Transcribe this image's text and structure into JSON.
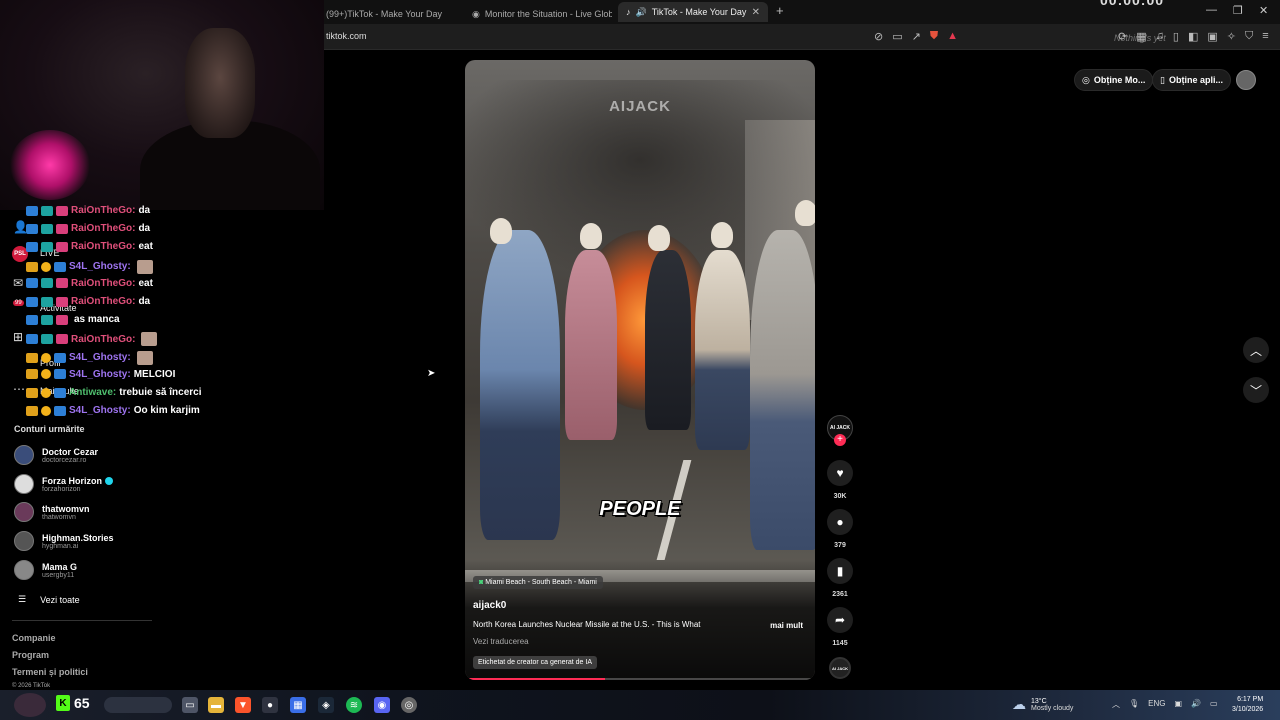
{
  "browser": {
    "tabs": [
      {
        "title": "(99+)TikTok - Make Your Day",
        "active": false
      },
      {
        "title": "Monitor the Situation - Live Global N",
        "active": false
      },
      {
        "title": "TikTok - Make Your Day",
        "active": true
      }
    ],
    "new_tab": "+",
    "close_tab": "✕",
    "url": "tiktok.com",
    "ghost_text": "Nothing's yet",
    "clock_overlay": "00:00:00",
    "window_controls": [
      "—",
      "❐",
      "✕"
    ]
  },
  "chat": {
    "lines": [
      {
        "user": "RaiOnTheGo:",
        "message": "da",
        "user_type": "rai",
        "emote": false
      },
      {
        "user": "RaiOnTheGo:",
        "message": "da",
        "user_type": "rai",
        "emote": false
      },
      {
        "user": "RaiOnTheGo:",
        "message": "eat",
        "user_type": "rai",
        "emote": false
      },
      {
        "user": "S4L_Ghosty:",
        "message": "",
        "user_type": "s4l",
        "emote": true
      },
      {
        "user": "RaiOnTheGo:",
        "message": "eat",
        "user_type": "rai",
        "emote": false
      },
      {
        "user": "RaiOnTheGo:",
        "message": "da",
        "user_type": "rai",
        "emote": false
      },
      {
        "user": "",
        "message": "as manca",
        "user_type": "rai",
        "emote": false
      },
      {
        "user": "RaiOnTheGo:",
        "message": "",
        "user_type": "rai",
        "emote": true
      },
      {
        "user": "S4L_Ghosty:",
        "message": "",
        "user_type": "s4l",
        "emote": true
      },
      {
        "user": "S4L_Ghosty:",
        "message": "MELCIOI",
        "user_type": "s4l",
        "emote": false
      },
      {
        "user": "Antiwave:",
        "message": "trebuie să încerci",
        "user_type": "anti",
        "emote": false
      },
      {
        "user": "S4L_Ghosty:",
        "message": "Oo kim karjim",
        "user_type": "s4l",
        "emote": false
      }
    ]
  },
  "sidebar": {
    "nav_labels": {
      "live": "LIVE",
      "activity": "Activitate",
      "profile": "Profil",
      "more": "Mai multe"
    },
    "live_badge": "PSL",
    "activity_count": "99",
    "following_title": "Conturi urmărite",
    "following": [
      {
        "name": "Doctor Cezar",
        "handle": "doctorcezar.ro",
        "verified": false
      },
      {
        "name": "Forza Horizon",
        "handle": "forzahorizon",
        "verified": true
      },
      {
        "name": "thatwomvn",
        "handle": "thatwomvn",
        "verified": false
      },
      {
        "name": "Highman.Stories",
        "handle": "hyghman.ai",
        "verified": false
      },
      {
        "name": "Mama G",
        "handle": "usergby11",
        "verified": false
      }
    ],
    "see_all": "Vezi toate",
    "footer_links": [
      "Companie",
      "Program",
      "Termeni și politici"
    ],
    "footer_small": "© 2026 TikTok"
  },
  "video": {
    "watermark": "AIJACK",
    "caption": "PEOPLE",
    "location": "Miami Beach - South Beach - Miami",
    "author": "aijack0",
    "description": "North Korea Launches Nuclear Missile at the U.S. - This is What",
    "more": "mai mult",
    "translate": "Vezi traducerea",
    "ai_label": "Etichetat de creator ca generat de IA",
    "progress": 0.4
  },
  "actions": {
    "avatar_label": "AI JACK",
    "likes": "30K",
    "comments": "379",
    "saves": "2361",
    "shares": "1145",
    "disc_label": "AI JACK"
  },
  "top_right": {
    "get_coins": "Obține Mo...",
    "get_app": "Obține apli..."
  },
  "taskbar": {
    "counter": "65",
    "weather_temp": "13°C",
    "weather_desc": "Mostly cloudy",
    "lang": "ENG",
    "time": "6:17 PM",
    "date": "3/10/2026"
  }
}
